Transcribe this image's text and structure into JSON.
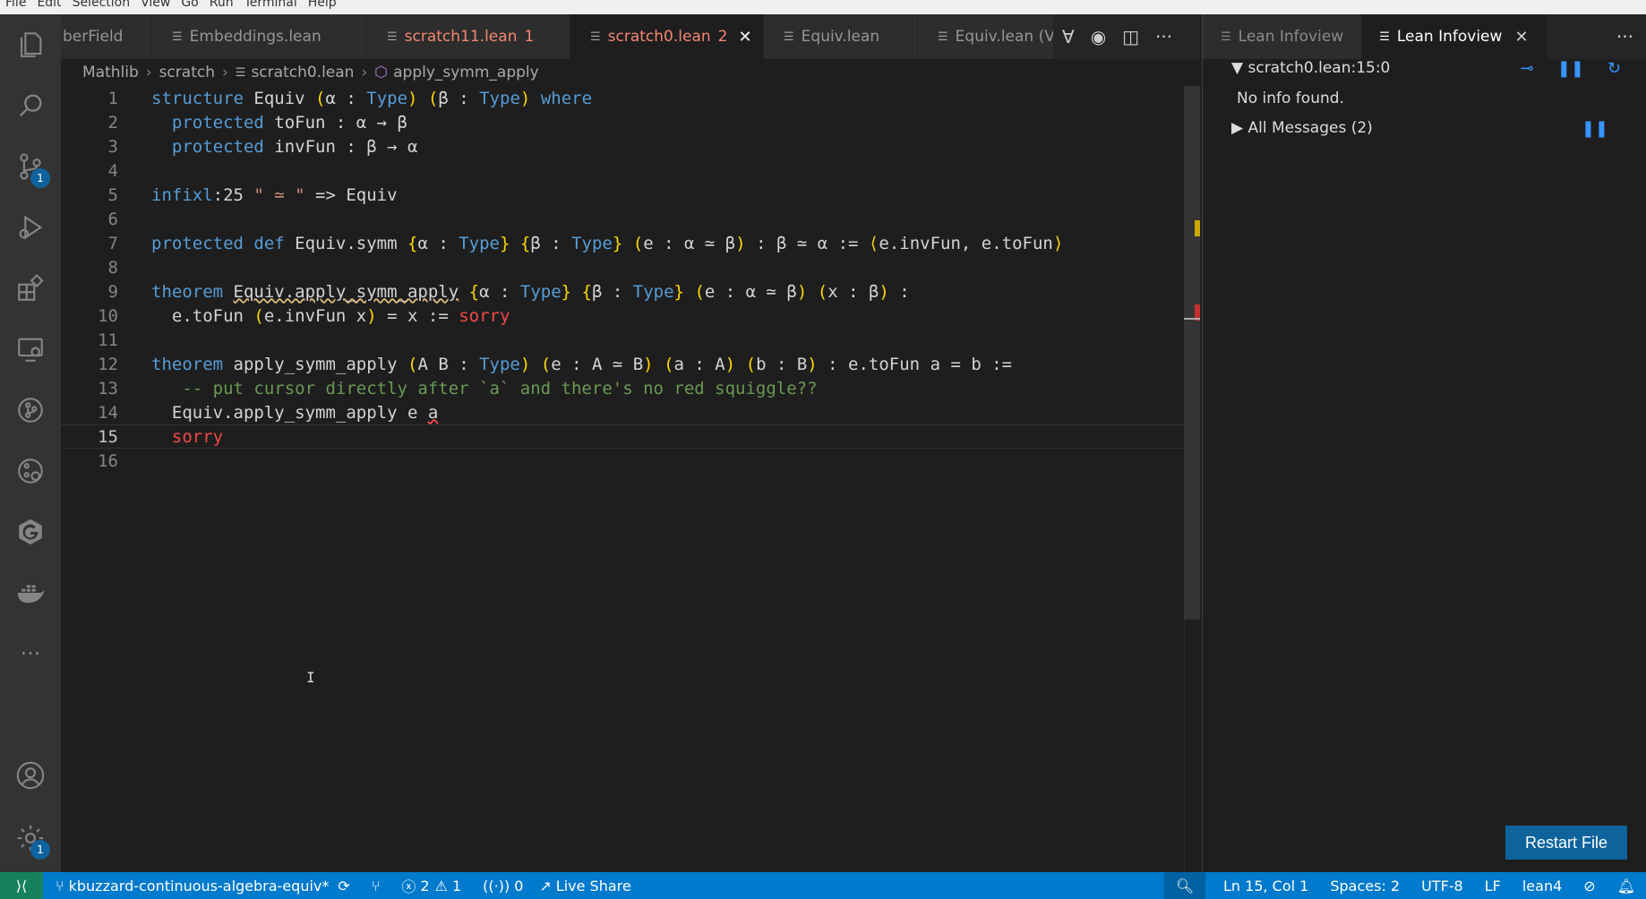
{
  "menubar": [
    "File",
    "Edit",
    "Selection",
    "View",
    "Go",
    "Run",
    "Terminal",
    "Help"
  ],
  "activity": {
    "scm_badge": "1",
    "settings_badge": "1"
  },
  "tabs": [
    {
      "label": "berField",
      "state": "normal",
      "suffix": ""
    },
    {
      "label": "Embeddings.lean",
      "state": "normal",
      "suffix": ""
    },
    {
      "label": "scratch11.lean",
      "state": "modified",
      "suffix": "1"
    },
    {
      "label": "scratch0.lean",
      "state": "active",
      "suffix": "2"
    },
    {
      "label": "Equiv.lean",
      "state": "normal",
      "suffix": ""
    },
    {
      "label": "Equiv.lean (V",
      "state": "normal",
      "suffix": ""
    }
  ],
  "breadcrumb": [
    "Mathlib",
    "scratch",
    "scratch0.lean",
    "apply_symm_apply"
  ],
  "editor": {
    "line_numbers": [
      "1",
      "2",
      "3",
      "4",
      "5",
      "6",
      "7",
      "8",
      "9",
      "10",
      "11",
      "12",
      "13",
      "14",
      "15",
      "16"
    ],
    "current_line": "15"
  },
  "infoview": {
    "tabs": [
      "Lean Infoview",
      "Lean Infoview"
    ],
    "position": "scratch0.lean:15:0",
    "no_info": "No info found.",
    "all_messages": "All Messages (2)",
    "restart_button": "Restart File"
  },
  "statusbar": {
    "branch": "kbuzzard-continuous-algebra-equiv*",
    "errors": "2",
    "warnings": "1",
    "ports": "0",
    "live_share": "Live Share",
    "cursor": "Ln 15, Col 1",
    "spaces": "Spaces: 2",
    "encoding": "UTF-8",
    "eol": "LF",
    "language": "lean4"
  }
}
